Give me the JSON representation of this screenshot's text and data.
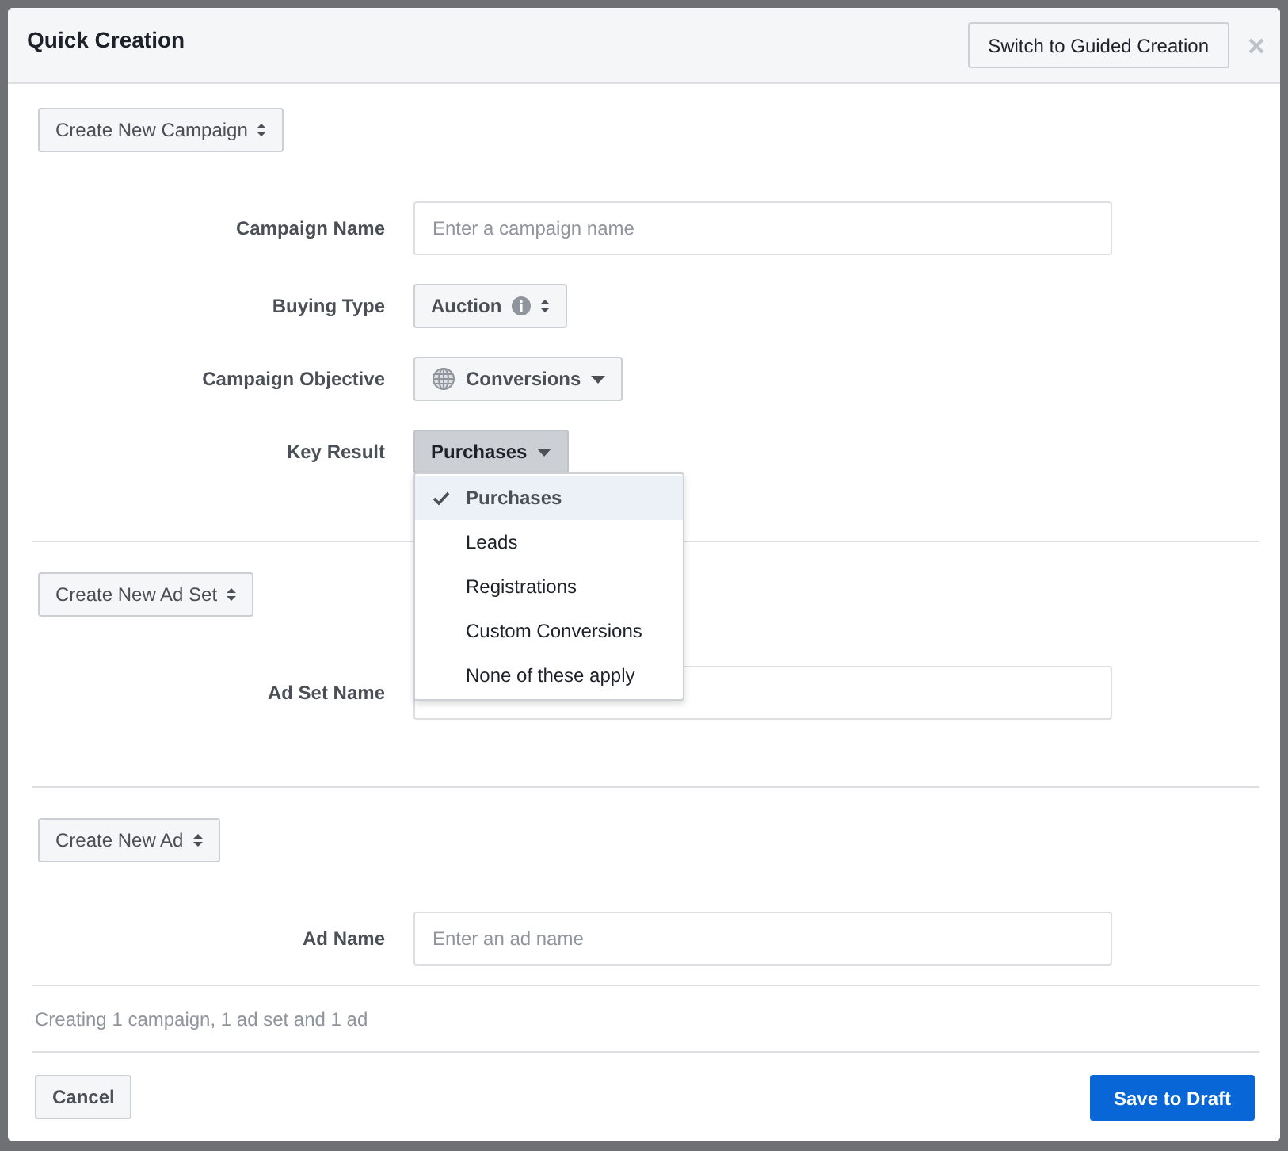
{
  "dialog": {
    "title": "Quick Creation",
    "switch_button": "Switch to Guided Creation"
  },
  "sections": [
    {
      "selector": "Create New Campaign",
      "fields": [
        {
          "kind": "text",
          "label": "Campaign Name",
          "placeholder": "Enter a campaign name"
        },
        {
          "kind": "select",
          "label": "Buying Type",
          "value": "Auction",
          "info": true
        },
        {
          "kind": "objective",
          "label": "Campaign Objective",
          "value": "Conversions",
          "expanded": false
        },
        {
          "kind": "dropdown",
          "label": "Key Result",
          "value": "Purchases",
          "expanded": true,
          "options": [
            {
              "label": "Purchases",
              "selected": true
            },
            {
              "label": "Leads",
              "selected": false
            },
            {
              "label": "Registrations",
              "selected": false
            },
            {
              "label": "Custom Conversions",
              "selected": false
            },
            {
              "label": "None of these apply",
              "selected": false
            }
          ]
        }
      ]
    },
    {
      "selector": "Create New Ad Set",
      "fields": [
        {
          "kind": "text",
          "label": "Ad Set Name"
        }
      ]
    },
    {
      "selector": "Create New Ad",
      "fields": [
        {
          "kind": "text",
          "label": "Ad Name",
          "placeholder": "Enter an ad name"
        }
      ]
    }
  ],
  "summary": "Creating 1 campaign, 1 ad set and 1 ad",
  "footer": {
    "cancel": "Cancel",
    "save": "Save to Draft"
  }
}
